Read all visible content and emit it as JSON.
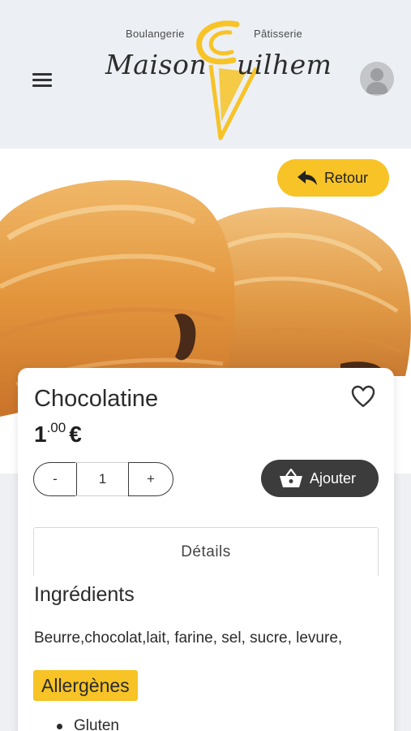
{
  "header": {
    "brand_left_sub": "Boulangerie",
    "brand_right_sub": "Pâtisserie",
    "brand_name_left": "Maison",
    "brand_name_right": "uilhem",
    "accent": "#f7c326"
  },
  "hero": {
    "back_label": "Retour",
    "back_icon": "reply-arrow-icon"
  },
  "product": {
    "name": "Chocolatine",
    "price_int": "1",
    "price_dec": ".00",
    "currency": "€",
    "quantity": "1",
    "minus_label": "-",
    "plus_label": "+",
    "add_label": "Ajouter",
    "add_icon": "basket-icon",
    "favorite_icon": "heart-outline-icon"
  },
  "details": {
    "tab_label": "Détails",
    "ingredients_title": "Ingrédients",
    "ingredients_text": "Beurre,chocolat,lait, farine, sel, sucre, levure,",
    "allergens_title": "Allergènes",
    "allergens": [
      "Gluten"
    ]
  }
}
